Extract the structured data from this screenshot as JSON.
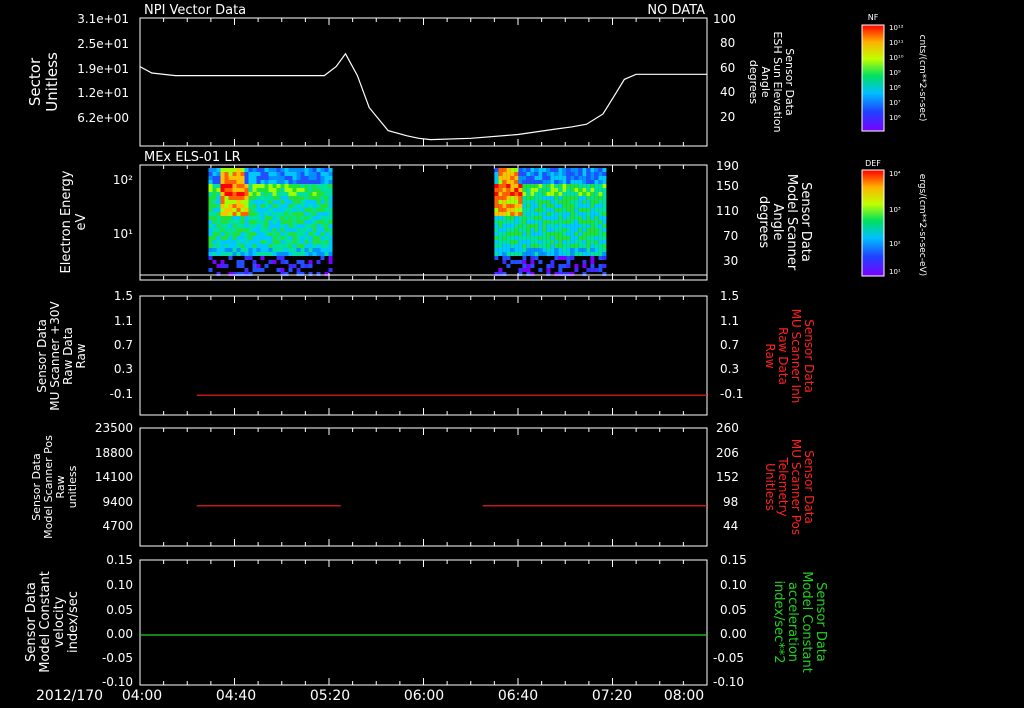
{
  "colors": {
    "background": "#000000",
    "axis": "#ffffff",
    "red": "#ff2020",
    "green": "#20d020"
  },
  "date_label": "2012/170",
  "x_ticks": [
    "04:00",
    "04:40",
    "05:20",
    "06:00",
    "06:40",
    "07:20",
    "08:00"
  ],
  "chart_data": [
    {
      "type": "line",
      "title_left": "NPI Vector Data",
      "title_right": "NO DATA",
      "ylabel_left": [
        "Sector",
        "Unitless"
      ],
      "ylabel_right": [
        "Sensor Data",
        "ESH Sun Elevation",
        "Angle",
        "degrees"
      ],
      "left_ticks": [
        "3.1e+01",
        "2.5e+01",
        "1.9e+01",
        "1.2e+01",
        "6.2e+00"
      ],
      "right_ticks": [
        "100",
        "80",
        "60",
        "40",
        "20"
      ],
      "right_axis_range": [
        0,
        100
      ],
      "series": [
        {
          "color": "#ffffff",
          "x_min": [
            0,
            5,
            15,
            25,
            45,
            78,
            83,
            87,
            92,
            97,
            105,
            113,
            118,
            123,
            140,
            160,
            175,
            183,
            189,
            196,
            201,
            205,
            210,
            215,
            225,
            240
          ],
          "y": [
            62,
            57,
            55,
            55,
            55,
            55,
            62,
            72,
            55,
            30,
            12,
            8,
            6,
            5,
            6,
            9,
            13,
            15,
            17,
            25,
            40,
            52,
            56,
            56,
            56,
            56
          ]
        }
      ]
    },
    {
      "type": "heatmap",
      "title_left": "MEx ELS-01 LR",
      "ylabel_left": [
        "Electron Energy",
        "eV"
      ],
      "ylabel_right": [
        "Sensor Data",
        "Model Scanner",
        "Angle",
        "degrees"
      ],
      "left_ticks": [
        "10²",
        "10¹"
      ],
      "right_ticks": [
        "190",
        "150",
        "110",
        "70",
        "30"
      ],
      "y_scale": "log",
      "right_axis_range": [
        10,
        190
      ],
      "blocks": [
        {
          "x_start_min": 29,
          "x_end_min": 80,
          "peak_at_min": 39
        },
        {
          "x_start_min": 150,
          "x_end_min": 196,
          "peak_at_min": 155
        }
      ],
      "flat_line_value": 10
    },
    {
      "type": "line",
      "ylabel_left": [
        "Sensor Data",
        "MU Scanner +30V",
        "Raw Data",
        "Raw"
      ],
      "ylabel_right": [
        "Sensor Data",
        "MU Scanner Inh",
        "Raw Data",
        "Raw"
      ],
      "left_ticks": [
        "1.5",
        "1.1",
        "0.7",
        "0.3",
        "-0.1"
      ],
      "right_ticks": [
        "1.5",
        "1.1",
        "0.7",
        "0.3",
        "-0.1"
      ],
      "y_range": [
        -0.3,
        1.5
      ],
      "series": [
        {
          "color": "#ff2020",
          "segments": [
            [
              24,
              240,
              0.0
            ]
          ]
        }
      ]
    },
    {
      "type": "line",
      "ylabel_left": [
        "Sensor Data",
        "Model Scanner Pos",
        "Raw",
        "unitless"
      ],
      "ylabel_right": [
        "Sensor Data",
        "MU Scanner Pos",
        "Telemetry",
        "Unitless"
      ],
      "left_ticks": [
        "23500",
        "18800",
        "14100",
        "9400",
        "4700"
      ],
      "right_ticks": [
        "260",
        "206",
        "152",
        "98",
        "44"
      ],
      "y_range": [
        0,
        23500
      ],
      "series": [
        {
          "color": "#ff2020",
          "segments": [
            [
              24,
              85,
              8000
            ],
            [
              145,
              240,
              8000
            ]
          ]
        }
      ]
    },
    {
      "type": "line",
      "ylabel_left": [
        "Sensor Data",
        "Model Constant",
        "velocity",
        "index/sec"
      ],
      "ylabel_right": [
        "Sensor Data",
        "Model Constant",
        "acceleration",
        "index/sec**2"
      ],
      "left_ticks": [
        "0.15",
        "0.10",
        "0.05",
        "0.00",
        "-0.05",
        "-0.10"
      ],
      "right_ticks": [
        "0.15",
        "0.10",
        "0.05",
        "0.00",
        "-0.05",
        "-0.10"
      ],
      "y_range": [
        -0.1,
        0.15
      ],
      "series": [
        {
          "color": "#20d020",
          "segments": [
            [
              0,
              240,
              0.0
            ]
          ]
        }
      ]
    }
  ],
  "colorbars": [
    {
      "title": "NF",
      "unit": "cnts/(cm**2-sr-sec)",
      "ticks": [
        "10¹²",
        "10¹¹",
        "10¹⁰",
        "10⁹",
        "10⁸",
        "10⁷",
        "10⁶"
      ]
    },
    {
      "title": "DEF",
      "unit": "ergs/(cm**2-sr-sec-eV)",
      "ticks": [
        "10⁴",
        "10³",
        "10²",
        "10¹"
      ]
    }
  ]
}
